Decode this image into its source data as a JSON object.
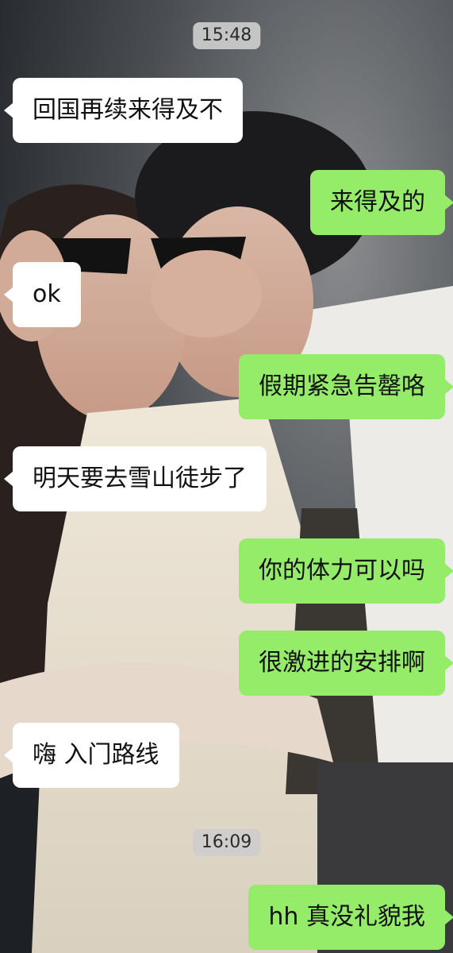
{
  "timestamps": [
    "15:48",
    "16:09"
  ],
  "messages": [
    {
      "side": "in",
      "text": "回国再续来得及不"
    },
    {
      "side": "out",
      "text": "来得及的"
    },
    {
      "side": "in",
      "text": "ok"
    },
    {
      "side": "out",
      "text": "假期紧急告罄咯"
    },
    {
      "side": "in",
      "text": "明天要去雪山徒步了"
    },
    {
      "side": "out",
      "text": "你的体力可以吗"
    },
    {
      "side": "out",
      "text": "很激进的安排啊"
    },
    {
      "side": "in",
      "text": "嗨 入门路线"
    },
    {
      "side": "out",
      "text": "hh 真没礼貌我"
    }
  ],
  "colors": {
    "incoming_bubble": "#ffffff",
    "outgoing_bubble": "#95ec69",
    "timestamp_bg": "#cdcdcd"
  }
}
